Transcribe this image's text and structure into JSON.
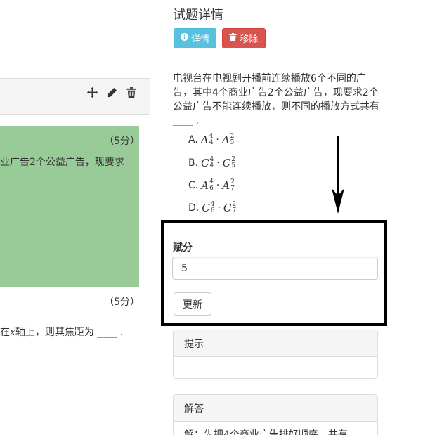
{
  "left": {
    "tools": [
      "move-icon",
      "pencil-icon",
      "trash-icon"
    ],
    "q1": {
      "score": "（5分）",
      "text": "业广告2个公益广告，现要求"
    },
    "q2": {
      "score": "（5分）",
      "text_prefix": "在",
      "text_var": "x",
      "text_suffix": "轴上，则其焦距为 ____ ."
    }
  },
  "detail": {
    "title": "试题详情",
    "info_button": "详情",
    "remove_button": "移除",
    "stem": "电视台在电视剧开播前连续播放6个不同的广告，其中4个商业广告2个公益广告，现要求2个公益广告不能连续播放，则不同的播放方式共有 ____ .",
    "options": [
      {
        "label": "A.",
        "f1": "A",
        "s1": "4",
        "b1": "4",
        "f2": "A",
        "s2": "2",
        "b2": "5"
      },
      {
        "label": "B.",
        "f1": "C",
        "s1": "4",
        "b1": "4",
        "f2": "C",
        "s2": "2",
        "b2": "5"
      },
      {
        "label": "C.",
        "f1": "A",
        "s1": "4",
        "b1": "6",
        "f2": "A",
        "s2": "2",
        "b2": "7"
      },
      {
        "label": "D.",
        "f1": "C",
        "s1": "4",
        "b1": "6",
        "f2": "C",
        "s2": "2",
        "b2": "7"
      }
    ],
    "dot": "·"
  },
  "score_form": {
    "label": "赋分",
    "value": "5",
    "update_button": "更新"
  },
  "hint_panel": {
    "title": "提示",
    "body": ""
  },
  "answer_panel": {
    "title": "解答",
    "body": "解：先把4个商业广告排好顺序，共有"
  },
  "colors": {
    "active_card": "#98cb98",
    "info": "#5bc0de",
    "danger": "#d9534f"
  }
}
